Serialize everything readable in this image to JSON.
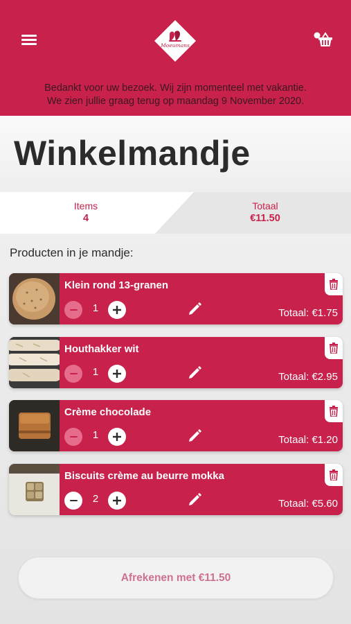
{
  "header": {
    "menu_icon": "hamburger-menu-icon",
    "logo_text": "Moeumans",
    "basket_icon": "shopping-basket-icon",
    "notice_line1": "Bedankt voor uw bezoek. Wij zijn momenteel met vakantie.",
    "notice_line2": "We zien jullie graag terug op maandag 9 November 2020."
  },
  "page": {
    "title": "Winkelmandje"
  },
  "summary": {
    "items_label": "Items",
    "items_value": "4",
    "total_label": "Totaal",
    "total_value": "€11.50"
  },
  "cart": {
    "section_label": "Producten in je mandje:",
    "items": [
      {
        "name": "Klein rond 13-granen",
        "quantity": "1",
        "total": "Totaal: €1.75"
      },
      {
        "name": "Houthakker wit",
        "quantity": "1",
        "total": "Totaal: €2.95"
      },
      {
        "name": "Crème chocolade",
        "quantity": "1",
        "total": "Totaal: €1.20"
      },
      {
        "name": "Biscuits crème au beurre mokka",
        "quantity": "2",
        "total": "Totaal: €5.60"
      }
    ]
  },
  "checkout": {
    "label": "Afrekenen met €11.50"
  },
  "colors": {
    "brand": "#c8214b",
    "minus_disabled": "#e56c8a",
    "checkout_text": "#d07090"
  }
}
